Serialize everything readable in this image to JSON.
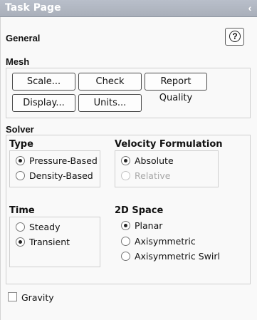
{
  "titlebar": {
    "title": "Task Page",
    "collapse_glyph": "‹"
  },
  "general": {
    "label": "General",
    "help_glyph": "?"
  },
  "mesh": {
    "label": "Mesh",
    "buttons": {
      "scale": "Scale...",
      "check": "Check",
      "report_quality": "Report Quality",
      "display": "Display...",
      "units": "Units..."
    }
  },
  "solver": {
    "label": "Solver",
    "type": {
      "label": "Type",
      "options": [
        {
          "label": "Pressure-Based",
          "checked": true,
          "enabled": true
        },
        {
          "label": "Density-Based",
          "checked": false,
          "enabled": true
        }
      ]
    },
    "velocity_formulation": {
      "label": "Velocity Formulation",
      "options": [
        {
          "label": "Absolute",
          "checked": true,
          "enabled": true
        },
        {
          "label": "Relative",
          "checked": false,
          "enabled": false
        }
      ]
    },
    "time": {
      "label": "Time",
      "options": [
        {
          "label": "Steady",
          "checked": false,
          "enabled": true
        },
        {
          "label": "Transient",
          "checked": true,
          "enabled": true
        }
      ]
    },
    "space_2d": {
      "label": "2D Space",
      "options": [
        {
          "label": "Planar",
          "checked": true,
          "enabled": true
        },
        {
          "label": "Axisymmetric",
          "checked": false,
          "enabled": true
        },
        {
          "label": "Axisymmetric Swirl",
          "checked": false,
          "enabled": true
        }
      ]
    }
  },
  "gravity": {
    "label": "Gravity",
    "checked": false
  },
  "icons": {
    "collapse": "chevron-left-icon",
    "help": "help-icon"
  }
}
